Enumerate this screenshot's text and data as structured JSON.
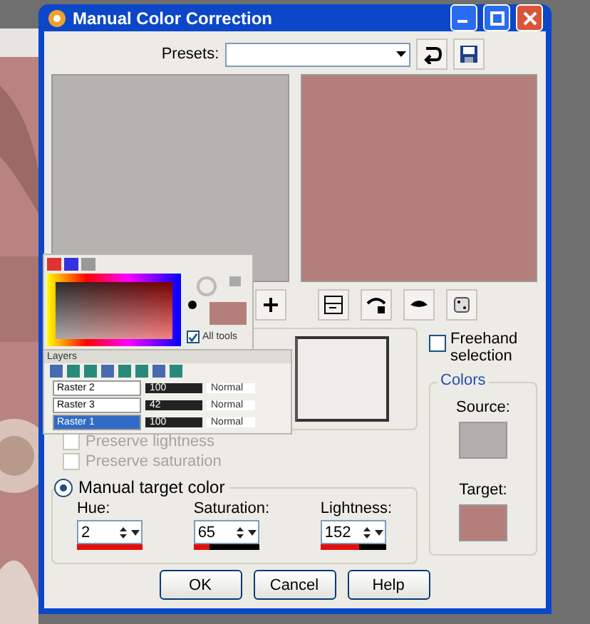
{
  "window": {
    "title": "Manual Color Correction"
  },
  "presets": {
    "label": "Presets:"
  },
  "options": [
    {
      "label": "Preserve lightness",
      "checked": false,
      "disabled": true
    },
    {
      "label": "Preserve saturation",
      "checked": false,
      "disabled": true
    }
  ],
  "manual_target": {
    "label": "Manual target color",
    "selected": true
  },
  "fields": [
    {
      "label": "Hue:",
      "value": "2",
      "level": 1
    },
    {
      "label": "Saturation:",
      "value": "65",
      "level": 0.25
    },
    {
      "label": "Lightness:",
      "value": "152",
      "level": 0.6
    }
  ],
  "freehand": {
    "label": "Freehand selection",
    "checked": false
  },
  "colors": {
    "title": "Colors",
    "source_label": "Source:",
    "target_label": "Target:"
  },
  "buttons": [
    "OK",
    "Cancel",
    "Help"
  ],
  "materials_palette": {
    "all_tools": {
      "label": "All tools",
      "checked": true
    }
  },
  "layers_palette": {
    "title": "Layers",
    "layers": [
      {
        "name": "Raster 2",
        "opacity": "100",
        "blend": "Normal",
        "selected": false
      },
      {
        "name": "Raster 3",
        "opacity": "42",
        "blend": "Normal",
        "selected": false
      },
      {
        "name": "Raster 1",
        "opacity": "100",
        "blend": "Normal",
        "selected": true
      }
    ]
  }
}
